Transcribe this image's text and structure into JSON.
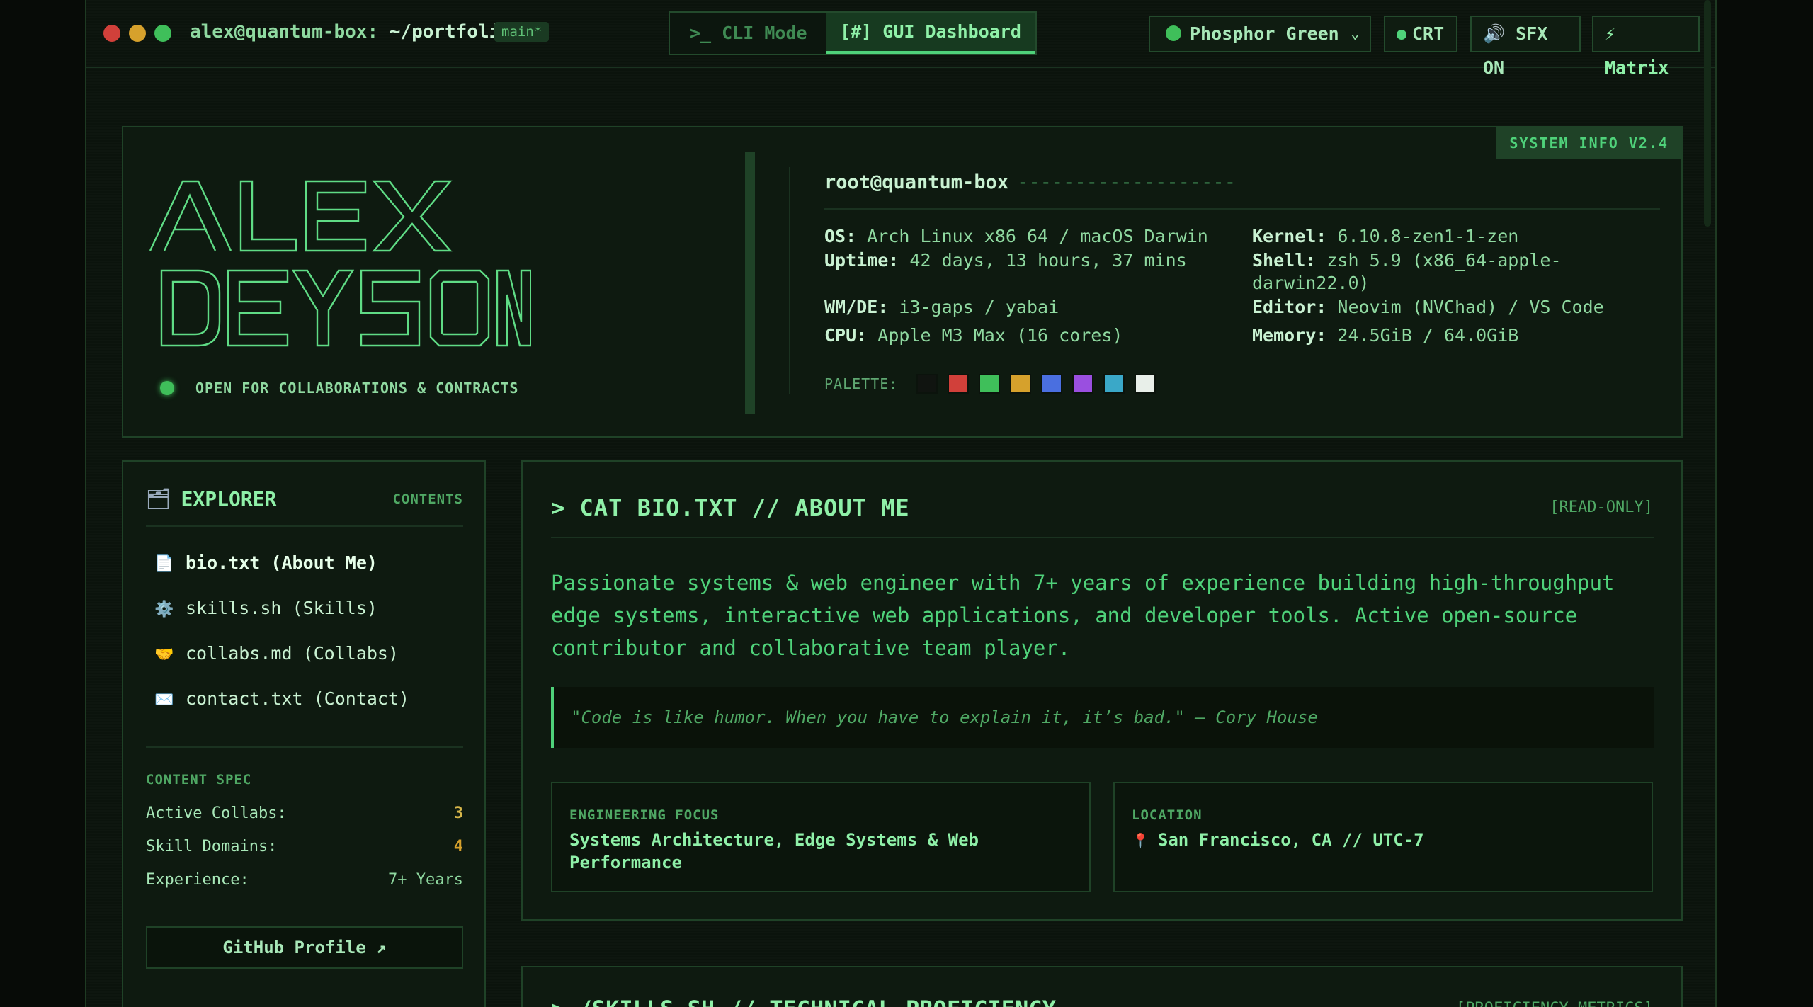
{
  "topbar": {
    "user_host": "alex@quantum-box:",
    "dir": "~/portfolio",
    "branch": "main*",
    "mode_cli": ">_ CLI Mode",
    "mode_gui": "[#] GUI Dashboard",
    "theme_label": "Phosphor Green",
    "crt_label": "CRT",
    "sfx_label": "🔊 SFX ON",
    "matrix_label": "⚡ Matrix"
  },
  "hero": {
    "badge": "SYSTEM INFO V2.4",
    "ascii_lines": [
      "  /\\   |    |--  \\/ ",
      "/--\\  |__  |__  /\\ ",
      "|\\ |-- \\/ /-- /-\\ |\\|",
      "|/ |__  |  --/ \\-/ | |"
    ],
    "status": "OPEN FOR COLLABORATIONS & CONTRACTS",
    "host": "root@quantum-box",
    "host_dashes": "-------------------",
    "info": {
      "os_k": "OS:",
      "os_v": "Arch Linux x86_64 / macOS Darwin",
      "uptime_k": "Uptime:",
      "uptime_v": "42 days, 13 hours, 37 mins",
      "wm_k": "WM/DE:",
      "wm_v": "i3-gaps / yabai",
      "cpu_k": "CPU:",
      "cpu_v": "Apple M3 Max (16 cores)",
      "kernel_k": "Kernel:",
      "kernel_v": "6.10.8-zen1-1-zen",
      "shell_k": "Shell:",
      "shell_v1": "zsh 5.9 (x86_64-apple-",
      "shell_v2": "darwin22.0)",
      "editor_k": "Editor:",
      "editor_v": "Neovim (NVChad) / VS Code",
      "memory_k": "Memory:",
      "memory_v": "24.5GiB / 64.0GiB"
    },
    "palette_label": "PALETTE:",
    "palette": [
      "#101410",
      "#d1403a",
      "#3fbf5a",
      "#d6a12c",
      "#4a6fe0",
      "#9a4fe0",
      "#3aa8c8",
      "#e8efe9"
    ]
  },
  "explorer": {
    "title": "EXPLORER",
    "folder_icon": "folder-icon",
    "contents_label": "CONTENTS",
    "items": [
      {
        "icon": "📄",
        "label": "bio.txt (About Me)"
      },
      {
        "icon": "⚙️",
        "label": "skills.sh (Skills)"
      },
      {
        "icon": "🤝",
        "label": "collabs.md (Collabs)"
      },
      {
        "icon": "✉️",
        "label": "contact.txt (Contact)"
      }
    ],
    "spec_title": "CONTENT SPEC",
    "spec": [
      {
        "k": "Active Collabs:",
        "v": "3"
      },
      {
        "k": "Skill Domains:",
        "v": "4"
      },
      {
        "k": "Experience:",
        "v": "7+ Years"
      }
    ],
    "github": "GitHub Profile ↗"
  },
  "about": {
    "title": "> CAT BIO.TXT // ABOUT ME",
    "readonly": "[READ-ONLY]",
    "body": "Passionate systems & web engineer with 7+ years of experience building high-throughput edge systems, interactive web applications, and developer tools. Active open-source contributor and collaborative team player.",
    "quote": "\"Code is like humor. When you have to explain it, it’s bad.\" — Cory House",
    "focus_label": "ENGINEERING FOCUS",
    "focus_value": "Systems Architecture, Edge Systems & Web Performance",
    "location_label": "LOCATION",
    "location_value": "San Francisco, CA // UTC-7"
  },
  "skills": {
    "title": "> /SKILLS.SH // TECHNICAL PROFICIENCY",
    "tag": "[PROFICIENCY METRICS]"
  },
  "colors": {
    "accent": "#4fd27a",
    "bright": "#8ff0a8",
    "border": "#1f4227"
  }
}
